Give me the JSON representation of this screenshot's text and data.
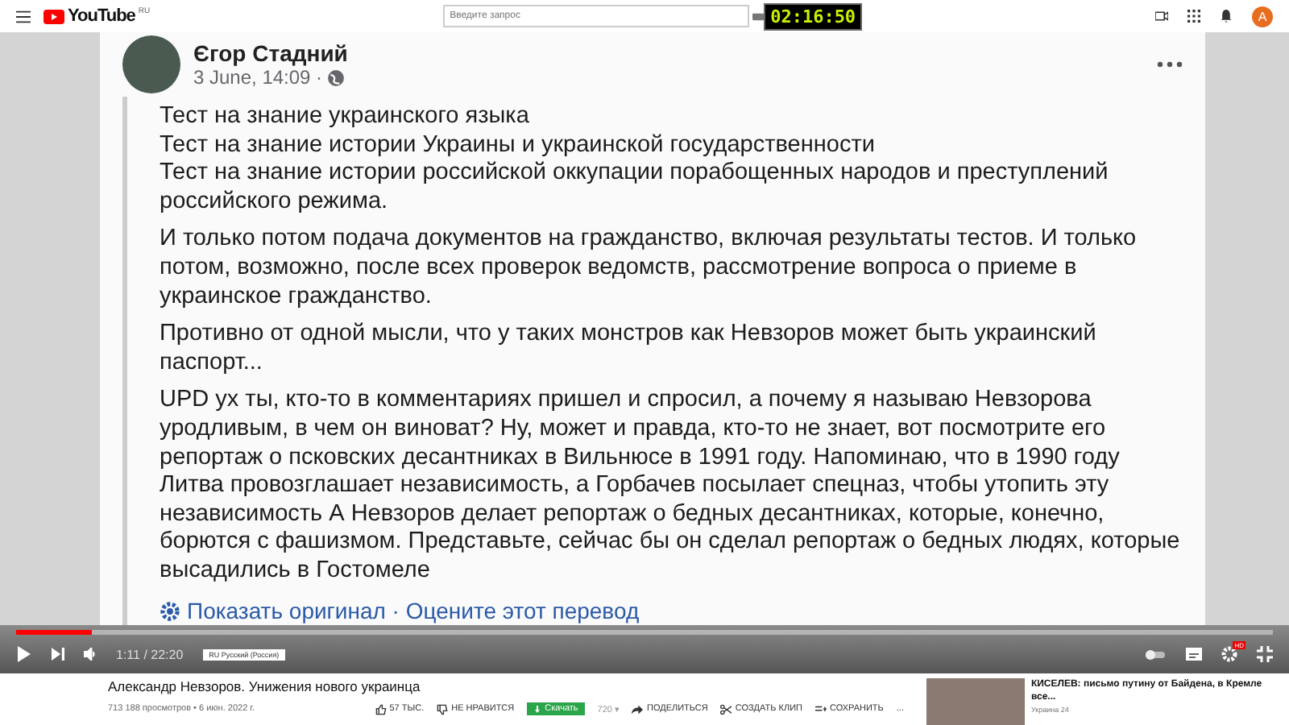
{
  "header": {
    "logo": "YouTube",
    "region": "RU",
    "search": {
      "placeholder": "Введите запрос"
    },
    "timer": "02:16:50",
    "avatar": "А"
  },
  "post": {
    "author": "Єгор Стадний",
    "date": "3 June, 14:09 ·",
    "paragraphs": [
      "Тест на знание украинского языка\nТест на знание истории Украины и украинской государственности\nТест на знание истории российской оккупации порабощенных народов и преступлений российского режима.",
      "И только потом подача документов на гражданство, включая результаты тестов. И только потом, возможно, после всех проверок ведомств, рассмотрение вопроса о приеме в украинское гражданство.",
      "Противно от одной мысли, что у таких монстров как Невзоров может быть украинский паспорт...",
      "UPD ух ты, кто-то в комментариях пришел и спросил, а почему я называю Невзорова уродливым, в чем он виноват? Ну, может и правда, кто-то не знает, вот посмотрите его репортаж о псковских десантниках в Вильнюсе в 1991 году. Напоминаю, что в 1990 году Литва провозглашает независимость, а Горбачев посылает спецназ, чтобы утопить эту независимость А Невзоров делает репортаж о бедных десантниках, которые, конечно, борются с фашизмом. Представьте, сейчас бы он сделал репортаж о бедных людях, которые высадились в Гостомеле"
    ],
    "translate": "Показать оригинал · Оцените этот перевод"
  },
  "player": {
    "progress": {
      "level": 0.06
    },
    "time": "1:11 / 22:20",
    "subtitle_language": "RU Русский (Россия)",
    "settings_badge": "HD"
  },
  "video": {
    "title": "Александр Невзоров. Унижения нового украинца",
    "meta": "713 188 просмотров • 6 июн. 2022 г.",
    "actions": [
      {
        "kind": "like",
        "label": "57 ТЫС."
      },
      {
        "kind": "dislike",
        "label": "НЕ НРАВИТСЯ"
      },
      {
        "kind": "download",
        "label": "Скачать"
      },
      {
        "kind": "quality",
        "label": "720 ▾"
      },
      {
        "kind": "share",
        "label": "ПОДЕЛИТЬСЯ"
      },
      {
        "kind": "clip",
        "label": "СОЗДАТЬ КЛИП"
      },
      {
        "kind": "save",
        "label": "СОХРАНИТЬ"
      },
      {
        "kind": "more",
        "label": "..."
      }
    ]
  },
  "recommendation": {
    "title": "КИСЕЛЕВ: письмо путину от Байдена, в Кремле все...",
    "channel": "Украина 24"
  }
}
